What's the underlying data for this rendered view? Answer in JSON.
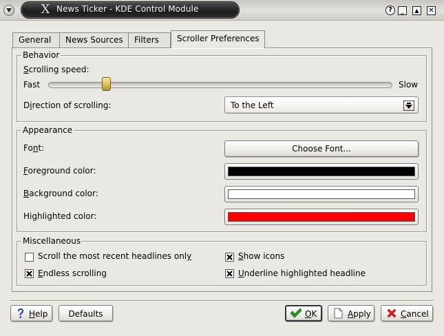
{
  "window": {
    "title": "News Ticker - KDE Control Module",
    "title_glyph": "X",
    "controls": {
      "help": "?",
      "minimize": "_",
      "maximize": "▲",
      "close": "✕"
    }
  },
  "tabs": [
    {
      "label": "General",
      "active": false
    },
    {
      "label": "News Sources",
      "active": false
    },
    {
      "label": "Filters",
      "active": false
    },
    {
      "label": "Scroller Preferences",
      "active": true
    }
  ],
  "behavior": {
    "legend": "Behavior",
    "speed_label_u": "S",
    "speed_label_rest": "crolling speed:",
    "fast_label": "Fast",
    "slow_label": "Slow",
    "speed_value": 0.16,
    "direction_label_pre": "D",
    "direction_label_u": "i",
    "direction_label_rest": "rection of scrolling:",
    "direction_value": "To the Left"
  },
  "appearance": {
    "legend": "Appearance",
    "font_label_pre": "Fo",
    "font_label_u": "n",
    "font_label_rest": "t:",
    "choose_font": "Choose Font...",
    "fg_label_u": "F",
    "fg_label_rest": "oreground color:",
    "bg_label_u": "B",
    "bg_label_rest": "ackground color:",
    "hl_label_pre": "Hi",
    "hl_label_u": "g",
    "hl_label_rest": "hlighted color:",
    "colors": {
      "foreground": "#000000",
      "background": "#ffffff",
      "highlighted": "#ff0000"
    }
  },
  "misc": {
    "legend": "Miscellaneous",
    "scroll_recent_pre": "Scroll the most recent headlines onl",
    "scroll_recent_u": "y",
    "scroll_recent_checked": false,
    "show_icons_u": "S",
    "show_icons_rest": "how icons",
    "show_icons_checked": true,
    "endless_u": "E",
    "endless_rest": "ndless scrolling",
    "endless_checked": true,
    "underline_u": "U",
    "underline_rest": "nderline highlighted headline",
    "underline_checked": true
  },
  "buttons": {
    "help_u": "H",
    "help_rest": "elp",
    "defaults": "Defaults",
    "ok_u": "O",
    "ok_rest": "K",
    "apply_u": "A",
    "apply_rest": "pply",
    "cancel_u": "C",
    "cancel_rest": "ancel"
  },
  "icons": {
    "window_menu": "chevron-down-icon",
    "help": "question-icon",
    "ok": "checkmark-icon",
    "apply": "document-icon",
    "cancel": "red-x-icon",
    "combo": "arrow-down-icon"
  }
}
